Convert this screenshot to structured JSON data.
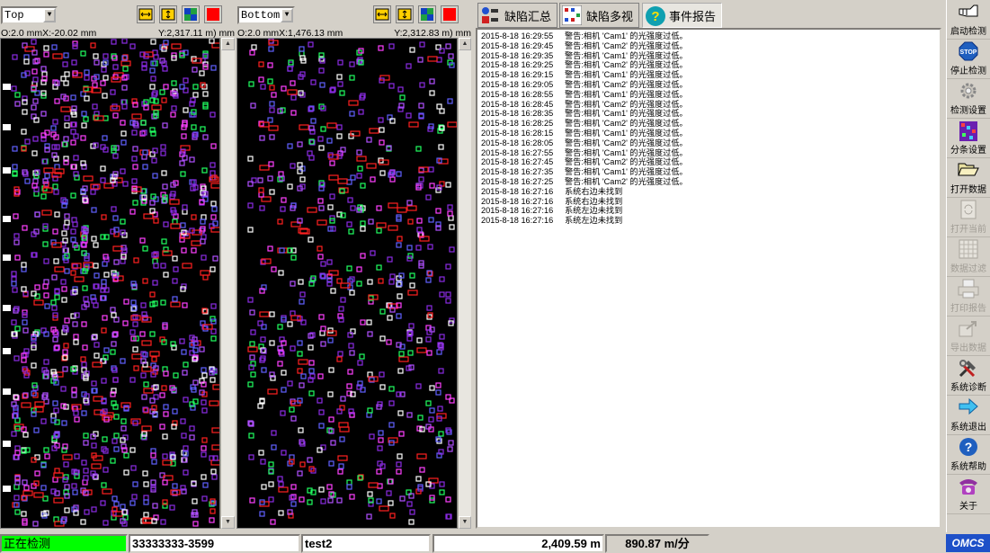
{
  "left_panel": {
    "surface_select": "Top",
    "coord_left": "O:2.0 mmX:-20.02 mm",
    "coord_right": "Y:2,317.11 m) mm"
  },
  "right_panel": {
    "surface_select": "Bottom",
    "coord_left": "O:2.0 mmX:1,476.13 mm",
    "coord_right": "Y:2,312.83 m) mm"
  },
  "tabs": [
    {
      "label": "缺陷汇总"
    },
    {
      "label": "缺陷多视"
    },
    {
      "label": "事件报告"
    }
  ],
  "event_log": [
    {
      "time": "2015-8-18 16:29:55",
      "msg": "警告:相机 'Cam1' 的光强度过低。"
    },
    {
      "time": "2015-8-18 16:29:45",
      "msg": "警告:相机 'Cam2' 的光强度过低。"
    },
    {
      "time": "2015-8-18 16:29:35",
      "msg": "警告:相机 'Cam1' 的光强度过低。"
    },
    {
      "time": "2015-8-18 16:29:25",
      "msg": "警告:相机 'Cam2' 的光强度过低。"
    },
    {
      "time": "2015-8-18 16:29:15",
      "msg": "警告:相机 'Cam1' 的光强度过低。"
    },
    {
      "time": "2015-8-18 16:29:05",
      "msg": "警告:相机 'Cam2' 的光强度过低。"
    },
    {
      "time": "2015-8-18 16:28:55",
      "msg": "警告:相机 'Cam1' 的光强度过低。"
    },
    {
      "time": "2015-8-18 16:28:45",
      "msg": "警告:相机 'Cam2' 的光强度过低。"
    },
    {
      "time": "2015-8-18 16:28:35",
      "msg": "警告:相机 'Cam1' 的光强度过低。"
    },
    {
      "time": "2015-8-18 16:28:25",
      "msg": "警告:相机 'Cam2' 的光强度过低。"
    },
    {
      "time": "2015-8-18 16:28:15",
      "msg": "警告:相机 'Cam1' 的光强度过低。"
    },
    {
      "time": "2015-8-18 16:28:05",
      "msg": "警告:相机 'Cam2' 的光强度过低。"
    },
    {
      "time": "2015-8-18 16:27:55",
      "msg": "警告:相机 'Cam1' 的光强度过低。"
    },
    {
      "time": "2015-8-18 16:27:45",
      "msg": "警告:相机 'Cam2' 的光强度过低。"
    },
    {
      "time": "2015-8-18 16:27:35",
      "msg": "警告:相机 'Cam1' 的光强度过低。"
    },
    {
      "time": "2015-8-18 16:27:25",
      "msg": "警告:相机 'Cam2' 的光强度过低。"
    },
    {
      "time": "2015-8-18 16:27:16",
      "msg": "系统右边未找到"
    },
    {
      "time": "2015-8-18 16:27:16",
      "msg": "系统右边未找到"
    },
    {
      "time": "2015-8-18 16:27:16",
      "msg": "系统左边未找到"
    },
    {
      "time": "2015-8-18 16:27:16",
      "msg": "系统左边未找到"
    }
  ],
  "sidebar": [
    {
      "label": "启动检测",
      "icon": "hand-pointer-icon",
      "enabled": true
    },
    {
      "label": "停止检测",
      "icon": "stop-icon",
      "enabled": true
    },
    {
      "label": "检测设置",
      "icon": "gear-icon",
      "enabled": true
    },
    {
      "label": "分条设置",
      "icon": "split-grid-icon",
      "enabled": true
    },
    {
      "label": "打开数据",
      "icon": "folder-open-icon",
      "enabled": true
    },
    {
      "label": "打开当前",
      "icon": "refresh-doc-icon",
      "enabled": false
    },
    {
      "label": "数据过滤",
      "icon": "filter-grid-icon",
      "enabled": false
    },
    {
      "label": "打印报告",
      "icon": "printer-icon",
      "enabled": false
    },
    {
      "label": "导出数据",
      "icon": "export-icon",
      "enabled": false
    },
    {
      "label": "系统诊断",
      "icon": "tools-icon",
      "enabled": true
    },
    {
      "label": "系统退出",
      "icon": "exit-arrow-icon",
      "enabled": true
    },
    {
      "label": "系统帮助",
      "icon": "help-icon",
      "enabled": true
    },
    {
      "label": "关于",
      "icon": "phone-icon",
      "enabled": true
    }
  ],
  "status_bar": {
    "state": "正在检测",
    "batch": "33333333-3599",
    "product": "test2",
    "length": "2,409.59 m",
    "speed": "890.87 m/分",
    "logo": "OMCS"
  },
  "colors": {
    "status_green": "#00ff00",
    "stop_red": "#ff0000",
    "view_bg": "#000000",
    "defect_purple": "#8a2be2",
    "defect_red": "#ff2020",
    "defect_green": "#20ff60",
    "defect_white": "#ffffff",
    "logo_blue": "#1e50c8"
  }
}
